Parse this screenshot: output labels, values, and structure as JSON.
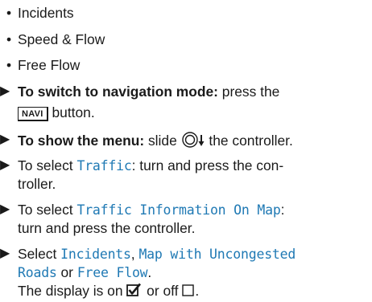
{
  "bullets": [
    "Incidents",
    "Speed & Flow",
    "Free Flow"
  ],
  "steps": {
    "navi_bold": "To switch to navigation mode:",
    "navi_text1": " press the",
    "navi_key": "NAVI",
    "navi_text2": " button.",
    "menu_bold": "To show the menu:",
    "menu_text1": " slide ",
    "menu_text2": " the controller.",
    "traffic_text1": "To select ",
    "traffic_mono": "Traffic",
    "traffic_text2": ": turn and press the con-",
    "traffic_text3": "troller.",
    "info_text1": "To select ",
    "info_mono": "Traffic Information On Map",
    "info_text2": ":",
    "info_text3": "turn and press the controller.",
    "sel_text1": "Select ",
    "sel_mono1": "Incidents",
    "sel_comma": ", ",
    "sel_mono2": "Map with Uncongested",
    "sel_mono3": "Roads",
    "sel_or": " or ",
    "sel_mono4": "Free Flow",
    "sel_dot": ".",
    "display_text1": "The display is on ",
    "display_text2": " or off ",
    "display_text3": "."
  },
  "icons": {
    "arrow": "right-triangle-icon",
    "controller": "controller-slide-down-icon",
    "checkbox_on": "checked-box-icon",
    "checkbox_off": "empty-box-icon"
  },
  "colors": {
    "highlight": "#1f79b4",
    "text": "#1a1a1a"
  }
}
